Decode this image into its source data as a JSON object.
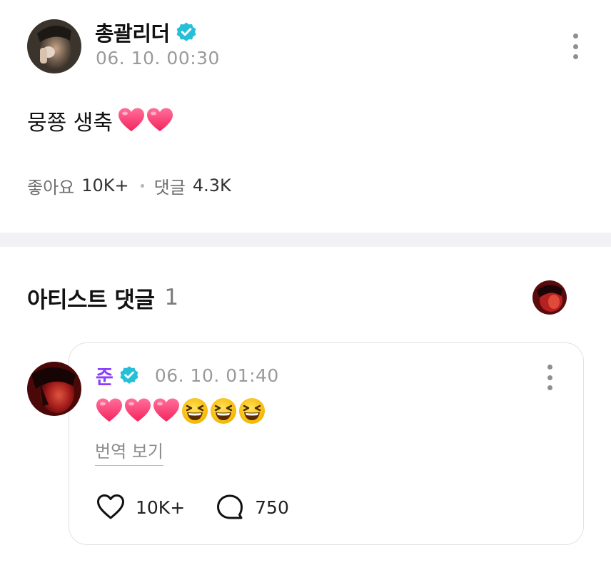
{
  "post": {
    "author": "총괄리더",
    "timestamp": "06. 10. 00:30",
    "body_text": "뭉쭁 생축",
    "body_emojis": [
      "heart",
      "heart"
    ],
    "likes_label": "좋아요",
    "likes_count": "10K+",
    "comments_label": "댓글",
    "comments_count": "4.3K",
    "more_icon": "more-vertical-icon",
    "verified_icon": "verified-badge-icon"
  },
  "artist_comments": {
    "title": "아티스트 댓글",
    "count": "1"
  },
  "comment": {
    "author": "준",
    "timestamp": "06. 10. 01:40",
    "emojis": [
      "heart",
      "heart",
      "heart",
      "laughing",
      "laughing",
      "laughing"
    ],
    "translate_label": "번역 보기",
    "likes_count": "10K+",
    "replies_count": "750"
  },
  "colors": {
    "verified": "#25c0d8",
    "artist_name": "#8a3ffc",
    "heart": "#ff3f78",
    "muted_text": "#9a9a9a",
    "divider": "#f2f2f4"
  }
}
